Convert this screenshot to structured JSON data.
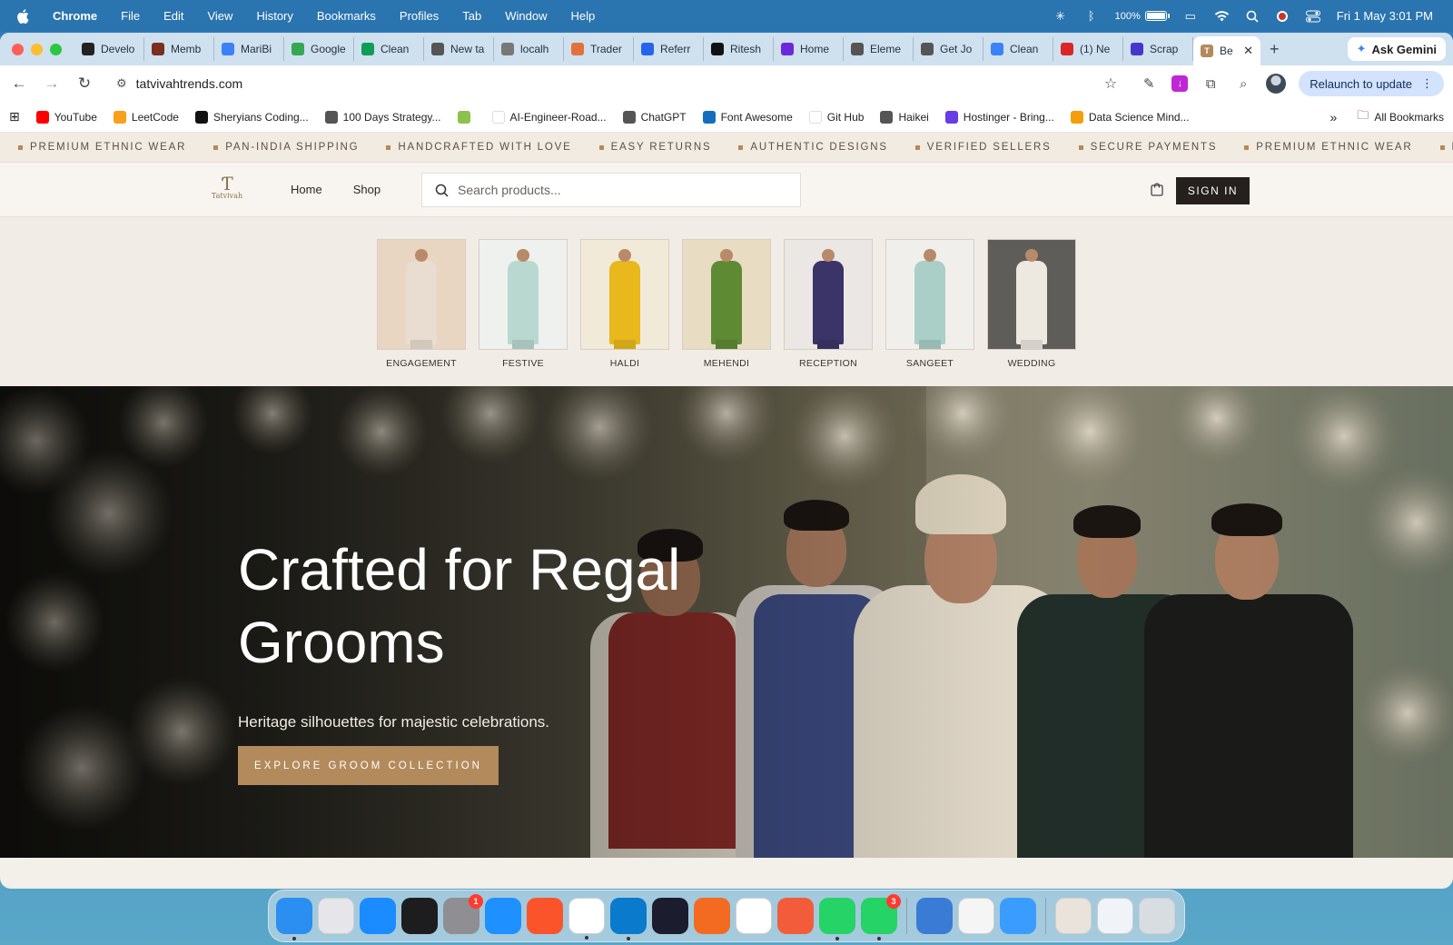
{
  "menubar": {
    "app_name": "Chrome",
    "menus": [
      "File",
      "Edit",
      "View",
      "History",
      "Bookmarks",
      "Profiles",
      "Tab",
      "Window",
      "Help"
    ],
    "battery_text": "100%",
    "battery_level": 1.0,
    "datetime": "Fri 1 May  3:01 PM"
  },
  "browser": {
    "tabs": [
      {
        "label": "Develo",
        "color": "#222222"
      },
      {
        "label": "Memb",
        "color": "#7a2e1e"
      },
      {
        "label": "MariBi",
        "color": "#3b82f6"
      },
      {
        "label": "Google",
        "color": "#34a853"
      },
      {
        "label": "Clean",
        "color": "#0f9d58"
      },
      {
        "label": "New ta",
        "color": "#555555"
      },
      {
        "label": "localh",
        "color": "#777777"
      },
      {
        "label": "Trader",
        "color": "#e2723b"
      },
      {
        "label": "Referr",
        "color": "#2563eb"
      },
      {
        "label": "Ritesh",
        "color": "#111111"
      },
      {
        "label": "Home",
        "color": "#6d28d9"
      },
      {
        "label": "Eleme",
        "color": "#555555"
      },
      {
        "label": "Get Jo",
        "color": "#555555"
      },
      {
        "label": "Clean",
        "color": "#3b82f6"
      },
      {
        "label": "(1) Ne",
        "color": "#dc2626"
      },
      {
        "label": "Scrap",
        "color": "#4338ca"
      }
    ],
    "active_tab": {
      "label": "Be",
      "color": "#b38a5b"
    },
    "ask_gemini": "Ask Gemini",
    "url": "tatvivahtrends.com",
    "relaunch": "Relaunch to update",
    "bookmarks": [
      {
        "label": "YouTube",
        "color": "#ff0000"
      },
      {
        "label": "LeetCode",
        "color": "#f89f1b"
      },
      {
        "label": "Sheryians Coding...",
        "color": "#111111"
      },
      {
        "label": "100 Days Strategy...",
        "color": "#555555"
      },
      {
        "label": "",
        "color": "#8bc34a"
      },
      {
        "label": "AI-Engineer-Road...",
        "color": "#ffffff"
      },
      {
        "label": "ChatGPT",
        "color": "#555555"
      },
      {
        "label": "Font Awesome",
        "color": "#146ebe"
      },
      {
        "label": "Git Hub",
        "color": "#ffffff"
      },
      {
        "label": "Haikei",
        "color": "#555555"
      },
      {
        "label": "Hostinger - Bring...",
        "color": "#673de6"
      },
      {
        "label": "Data Science Mind...",
        "color": "#f59e0b"
      }
    ],
    "all_bookmarks": "All Bookmarks"
  },
  "site": {
    "marquee": [
      "PREMIUM ETHNIC WEAR",
      "PAN-INDIA SHIPPING",
      "HANDCRAFTED WITH LOVE",
      "EASY RETURNS",
      "AUTHENTIC DESIGNS",
      "VERIFIED SELLERS",
      "SECURE PAYMENTS",
      "PREMIUM ETHNIC WEAR",
      "PAN-INDIA SHIPPIN"
    ],
    "logo_text": "Tatvivah",
    "nav": {
      "home": "Home",
      "shop": "Shop"
    },
    "search_placeholder": "Search products...",
    "sign_in": "SIGN IN",
    "categories": [
      {
        "label": "ENGAGEMENT",
        "outfit": "#e8ddd0",
        "bg": "#e9d6c2"
      },
      {
        "label": "FESTIVE",
        "outfit": "#b8d8d0",
        "bg": "#eef1ee"
      },
      {
        "label": "HALDI",
        "outfit": "#e8b81c",
        "bg": "#f2ead9"
      },
      {
        "label": "MEHENDI",
        "outfit": "#5f8a34",
        "bg": "#e8dcc2"
      },
      {
        "label": "RECEPTION",
        "outfit": "#3b3468",
        "bg": "#eae7e4"
      },
      {
        "label": "SANGEET",
        "outfit": "#a9cfc6",
        "bg": "#f1efec"
      },
      {
        "label": "WEDDING",
        "outfit": "#ede8e0",
        "bg": "#5e5d5a"
      }
    ],
    "hero": {
      "title": "Crafted for Regal Grooms",
      "subtitle": "Heritage silhouettes for majestic celebrations.",
      "cta": "EXPLORE GROOM COLLECTION"
    }
  },
  "dock": {
    "apps": [
      {
        "name": "Finder",
        "color": "#2a8ff0",
        "badge": "",
        "running": true
      },
      {
        "name": "Launchpad",
        "color": "#e6e6ea",
        "badge": "",
        "running": false
      },
      {
        "name": "App Store",
        "color": "#1a8cff",
        "badge": "",
        "running": false
      },
      {
        "name": "Activity Monitor",
        "color": "#1d1d1f",
        "badge": "",
        "running": false
      },
      {
        "name": "System Settings",
        "color": "#8e8e93",
        "badge": "1",
        "running": false
      },
      {
        "name": "Safari",
        "color": "#1e90ff",
        "badge": "",
        "running": false
      },
      {
        "name": "Brave",
        "color": "#fb542b",
        "badge": "",
        "running": false
      },
      {
        "name": "Chrome",
        "color": "#ffffff",
        "badge": "",
        "running": true
      },
      {
        "name": "VS Code",
        "color": "#0a7acc",
        "badge": "",
        "running": true
      },
      {
        "name": "Affinity",
        "color": "#1b1d2e",
        "badge": "",
        "running": false
      },
      {
        "name": "Pen Tool",
        "color": "#f26b21",
        "badge": "",
        "running": false
      },
      {
        "name": "ChatGPT",
        "color": "#ffffff",
        "badge": "",
        "running": false
      },
      {
        "name": "Claude",
        "color": "#f25c3b",
        "badge": "",
        "running": false
      },
      {
        "name": "WhatsApp",
        "color": "#25d366",
        "badge": "",
        "running": true
      },
      {
        "name": "WhatsApp Business",
        "color": "#25d366",
        "badge": "3",
        "running": true
      }
    ],
    "apps_right": [
      {
        "name": "Downloads",
        "color": "#3a7bd5"
      },
      {
        "name": "Notes",
        "color": "#f5f5f5"
      },
      {
        "name": "Mail",
        "color": "#3b9cff"
      }
    ],
    "trays": [
      {
        "name": "Documents",
        "color": "#e9e3dc"
      },
      {
        "name": "Screenshots",
        "color": "#f0f4f8"
      },
      {
        "name": "Trash",
        "color": "#d8dde2"
      }
    ]
  }
}
